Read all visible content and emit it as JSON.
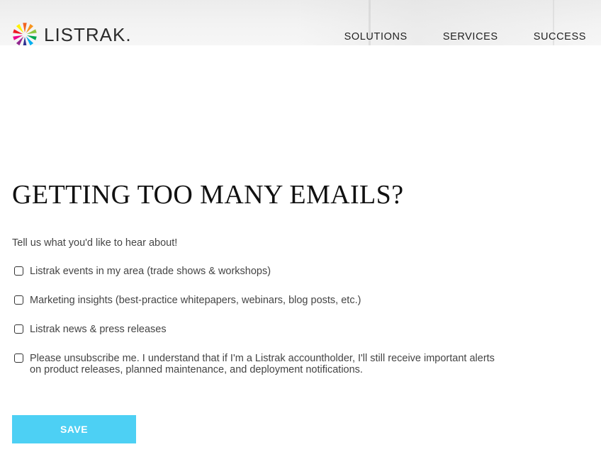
{
  "header": {
    "logo_text": "LISTRAK.",
    "nav": [
      {
        "label": "SOLUTIONS"
      },
      {
        "label": "SERVICES"
      },
      {
        "label": "SUCCESS"
      }
    ]
  },
  "main": {
    "title": "GETTING TOO MANY EMAILS?",
    "intro": "Tell us what you'd like to hear about!",
    "options": [
      {
        "label": "Listrak events in my area (trade shows & workshops)",
        "checked": false
      },
      {
        "label": "Marketing insights (best-practice whitepapers, webinars, blog posts, etc.)",
        "checked": false
      },
      {
        "label": "Listrak news & press releases",
        "checked": false
      },
      {
        "label": "Please unsubscribe me. I understand that if I'm a Listrak accountholder, I'll still receive important alerts on product releases, planned maintenance, and deployment notifications.",
        "checked": false
      }
    ],
    "save_label": "SAVE"
  },
  "colors": {
    "save_button": "#4dd0f4",
    "logo_rays": [
      "#f26522",
      "#f7941d",
      "#8dc63f",
      "#00a651",
      "#00aeef",
      "#2e3192",
      "#92278f",
      "#ec008c",
      "#ed1c24",
      "#fff200"
    ]
  },
  "icons": {
    "logo_mark": "starburst-logo-icon",
    "checkbox": "checkbox-icon"
  }
}
